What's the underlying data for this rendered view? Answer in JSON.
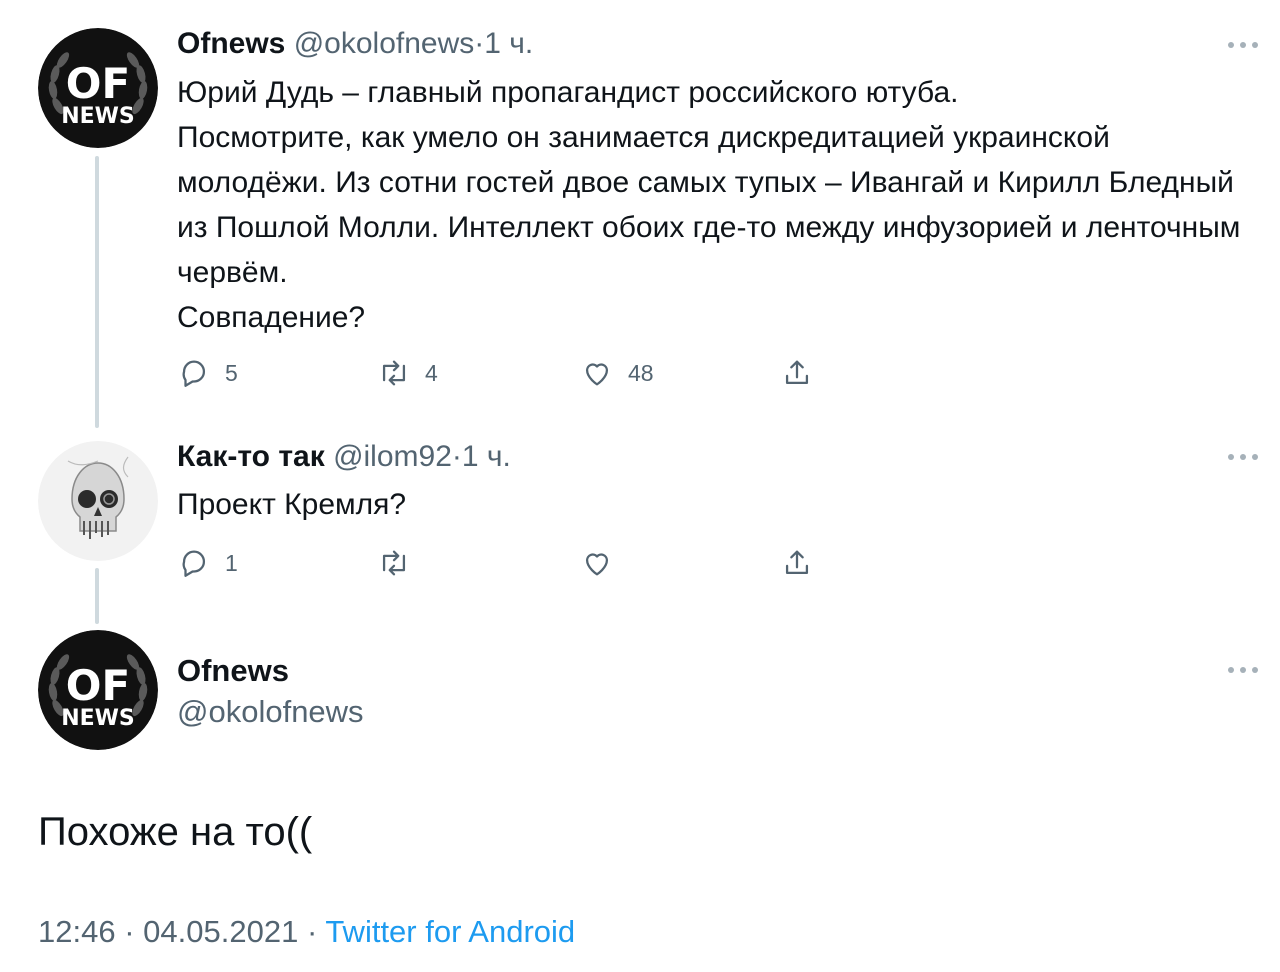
{
  "tweet1": {
    "name": "Ofnews",
    "handle": "@okolofnews",
    "separator": "·",
    "time": "1 ч.",
    "text": "Юрий Дудь – главный пропагандист российского ютуба.\nПосмотрите, как умело он занимается дискредитацией украинской молодёжи. Из сотни гостей двое самых тупых – Ивангай и Кирилл Бледный из Пошлой Молли. Интеллект обоих где-то между инфузорией и ленточным червём.\nСовпадение?",
    "reply_count": "5",
    "retweet_count": "4",
    "like_count": "48",
    "avatar": {
      "top_text": "OF",
      "bottom_text": "NEWS"
    }
  },
  "tweet2": {
    "name": "Как-то так",
    "handle": "@ilom92",
    "separator": "·",
    "time": "1 ч.",
    "text": "Проект Кремля?",
    "reply_count": "1",
    "retweet_count": "",
    "like_count": ""
  },
  "main_tweet": {
    "name": "Ofnews",
    "handle": "@okolofnews",
    "text": "Похоже на то((",
    "time": "12:46",
    "date": "04.05.2021",
    "separator": "·",
    "source": "Twitter for Android",
    "avatar": {
      "top_text": "OF",
      "bottom_text": "NEWS"
    }
  },
  "icons": [
    "reply-icon",
    "retweet-icon",
    "like-icon",
    "share-icon",
    "more-icon"
  ],
  "colors": {
    "text": "#0f1419",
    "secondary": "#536471",
    "link": "#1d9bf0",
    "thread_line": "#cfd9de"
  }
}
